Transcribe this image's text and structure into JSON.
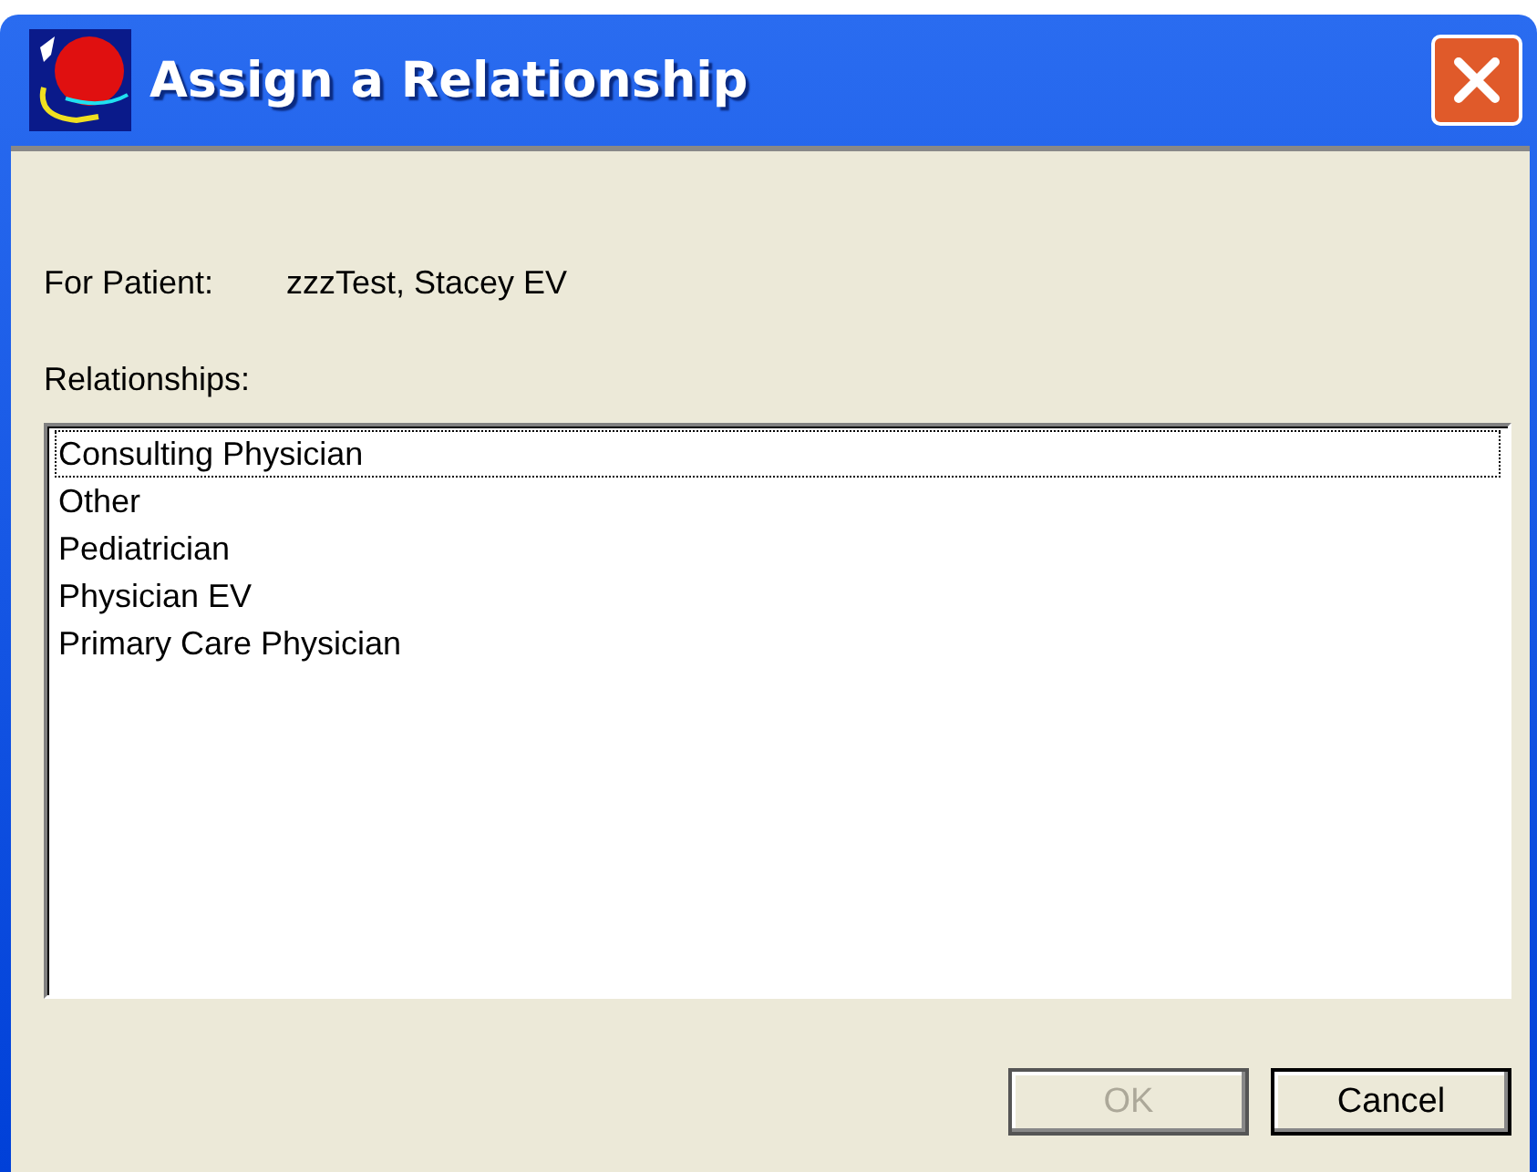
{
  "window": {
    "title": "Assign a Relationship"
  },
  "patient": {
    "label": "For Patient:",
    "value": "zzzTest, Stacey EV"
  },
  "relationships": {
    "label": "Relationships:",
    "items": [
      {
        "text": "Consulting Physician",
        "focused": true
      },
      {
        "text": "Other",
        "focused": false
      },
      {
        "text": "Pediatrician",
        "focused": false
      },
      {
        "text": "Physician EV",
        "focused": false
      },
      {
        "text": "Primary Care Physician",
        "focused": false
      }
    ]
  },
  "buttons": [
    {
      "label": "OK",
      "disabled": true
    },
    {
      "label": "Cancel",
      "disabled": false
    }
  ]
}
